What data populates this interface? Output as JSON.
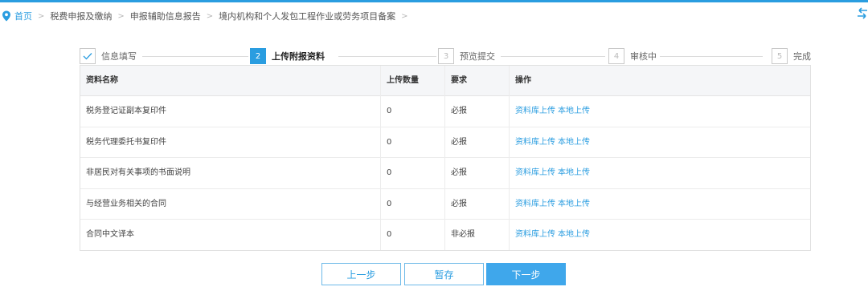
{
  "breadcrumb": {
    "home": "首页",
    "items": [
      "税费申报及缴纳",
      "申报辅助信息报告",
      "境内机构和个人发包工程作业或劳务项目备案"
    ]
  },
  "steps": [
    {
      "num": "",
      "label": "信息填写",
      "state": "done"
    },
    {
      "num": "2",
      "label": "上传附报资料",
      "state": "active"
    },
    {
      "num": "3",
      "label": "预览提交",
      "state": "todo"
    },
    {
      "num": "4",
      "label": "审核中",
      "state": "todo"
    },
    {
      "num": "5",
      "label": "完成",
      "state": "todo"
    }
  ],
  "table": {
    "headers": {
      "name": "资料名称",
      "count": "上传数量",
      "req": "要求",
      "op": "操作"
    },
    "link_repo": "资料库上传",
    "link_local": "本地上传",
    "rows": [
      {
        "name": "税务登记证副本复印件",
        "count": "0",
        "req": "必报"
      },
      {
        "name": "税务代理委托书复印件",
        "count": "0",
        "req": "必报"
      },
      {
        "name": "非居民对有关事项的书面说明",
        "count": "0",
        "req": "必报"
      },
      {
        "name": "与经营业务相关的合同",
        "count": "0",
        "req": "必报"
      },
      {
        "name": "合同中文译本",
        "count": "0",
        "req": "非必报"
      }
    ]
  },
  "buttons": {
    "prev": "上一步",
    "save": "暂存",
    "next": "下一步"
  },
  "colors": {
    "accent": "#2a9de0",
    "primary_button": "#3fa7eb"
  },
  "icons": {
    "breadcrumb": "location-pin-icon",
    "step_done": "check-icon",
    "side": "swap-arrows-icon"
  }
}
